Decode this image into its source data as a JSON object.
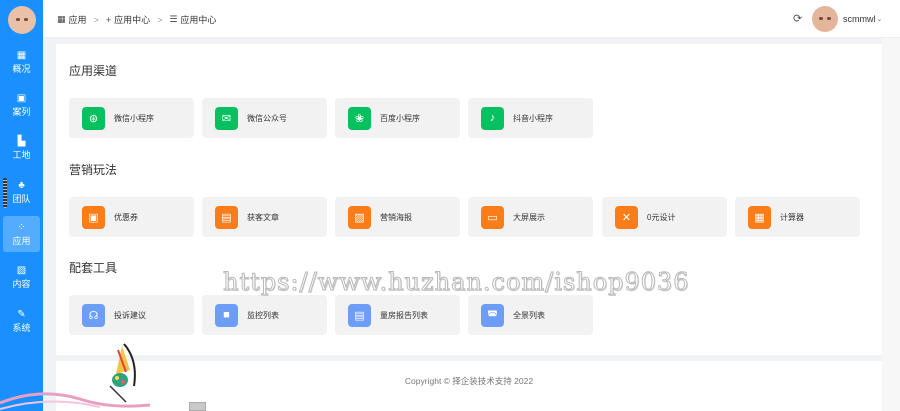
{
  "sidebar": {
    "items": [
      {
        "label": "概况",
        "icon": "grid-icon",
        "glyph": "▦"
      },
      {
        "label": "案列",
        "icon": "briefcase-icon",
        "glyph": "▣"
      },
      {
        "label": "工地",
        "icon": "building-icon",
        "glyph": "▙"
      },
      {
        "label": "团队",
        "icon": "team-icon",
        "glyph": "♣"
      },
      {
        "label": "应用",
        "icon": "apps-icon",
        "glyph": "⁘",
        "active": true
      },
      {
        "label": "内容",
        "icon": "image-icon",
        "glyph": "▨"
      },
      {
        "label": "系统",
        "icon": "paperclip-icon",
        "glyph": "✎"
      }
    ]
  },
  "breadcrumb": {
    "items": [
      {
        "label": "应用",
        "icon": "grid-icon",
        "glyph": "▦"
      },
      {
        "label": "应用中心",
        "icon": "plus-icon",
        "glyph": "+"
      },
      {
        "label": "应用中心",
        "icon": "list-icon",
        "glyph": "☰"
      }
    ],
    "separator": ">"
  },
  "header": {
    "username": "scmmwl"
  },
  "sections": [
    {
      "title": "应用渠道",
      "items": [
        {
          "label": "微信小程序",
          "icon": "wechat-miniprogram-icon",
          "color": "green",
          "glyph": "⊛"
        },
        {
          "label": "微信公众号",
          "icon": "wechat-icon",
          "color": "green",
          "glyph": "✉"
        },
        {
          "label": "百度小程序",
          "icon": "baidu-paw-icon",
          "color": "green",
          "glyph": "❀"
        },
        {
          "label": "抖音小程序",
          "icon": "tiktok-icon",
          "color": "green",
          "glyph": "♪"
        }
      ]
    },
    {
      "title": "营销玩法",
      "items": [
        {
          "label": "优惠券",
          "icon": "coupon-icon",
          "color": "orange",
          "glyph": "▣"
        },
        {
          "label": "获客文章",
          "icon": "article-icon",
          "color": "orange",
          "glyph": "▤"
        },
        {
          "label": "营销海报",
          "icon": "poster-icon",
          "color": "orange",
          "glyph": "▨"
        },
        {
          "label": "大屏展示",
          "icon": "monitor-icon",
          "color": "orange",
          "glyph": "▭"
        },
        {
          "label": "0元设计",
          "icon": "design-tools-icon",
          "color": "orange",
          "glyph": "✕"
        },
        {
          "label": "计算器",
          "icon": "calculator-icon",
          "color": "orange",
          "glyph": "▦"
        }
      ]
    },
    {
      "title": "配套工具",
      "items": [
        {
          "label": "投诉建议",
          "icon": "headset-icon",
          "color": "blue",
          "glyph": "☊"
        },
        {
          "label": "监控列表",
          "icon": "video-camera-icon",
          "color": "blue",
          "glyph": "■"
        },
        {
          "label": "量房报告列表",
          "icon": "report-icon",
          "color": "blue",
          "glyph": "▤"
        },
        {
          "label": "全景列表",
          "icon": "panorama-icon",
          "color": "blue",
          "glyph": "◚"
        }
      ]
    }
  ],
  "footer": {
    "text": "Copyright © 择企装技术支持 2022"
  },
  "watermark": {
    "text": "https://www.huzhan.com/ishop9036"
  },
  "colors": {
    "sidebar": "#1a90ff",
    "green": "#07c160",
    "orange": "#fa7d1a",
    "blue": "#6c9ef8"
  }
}
